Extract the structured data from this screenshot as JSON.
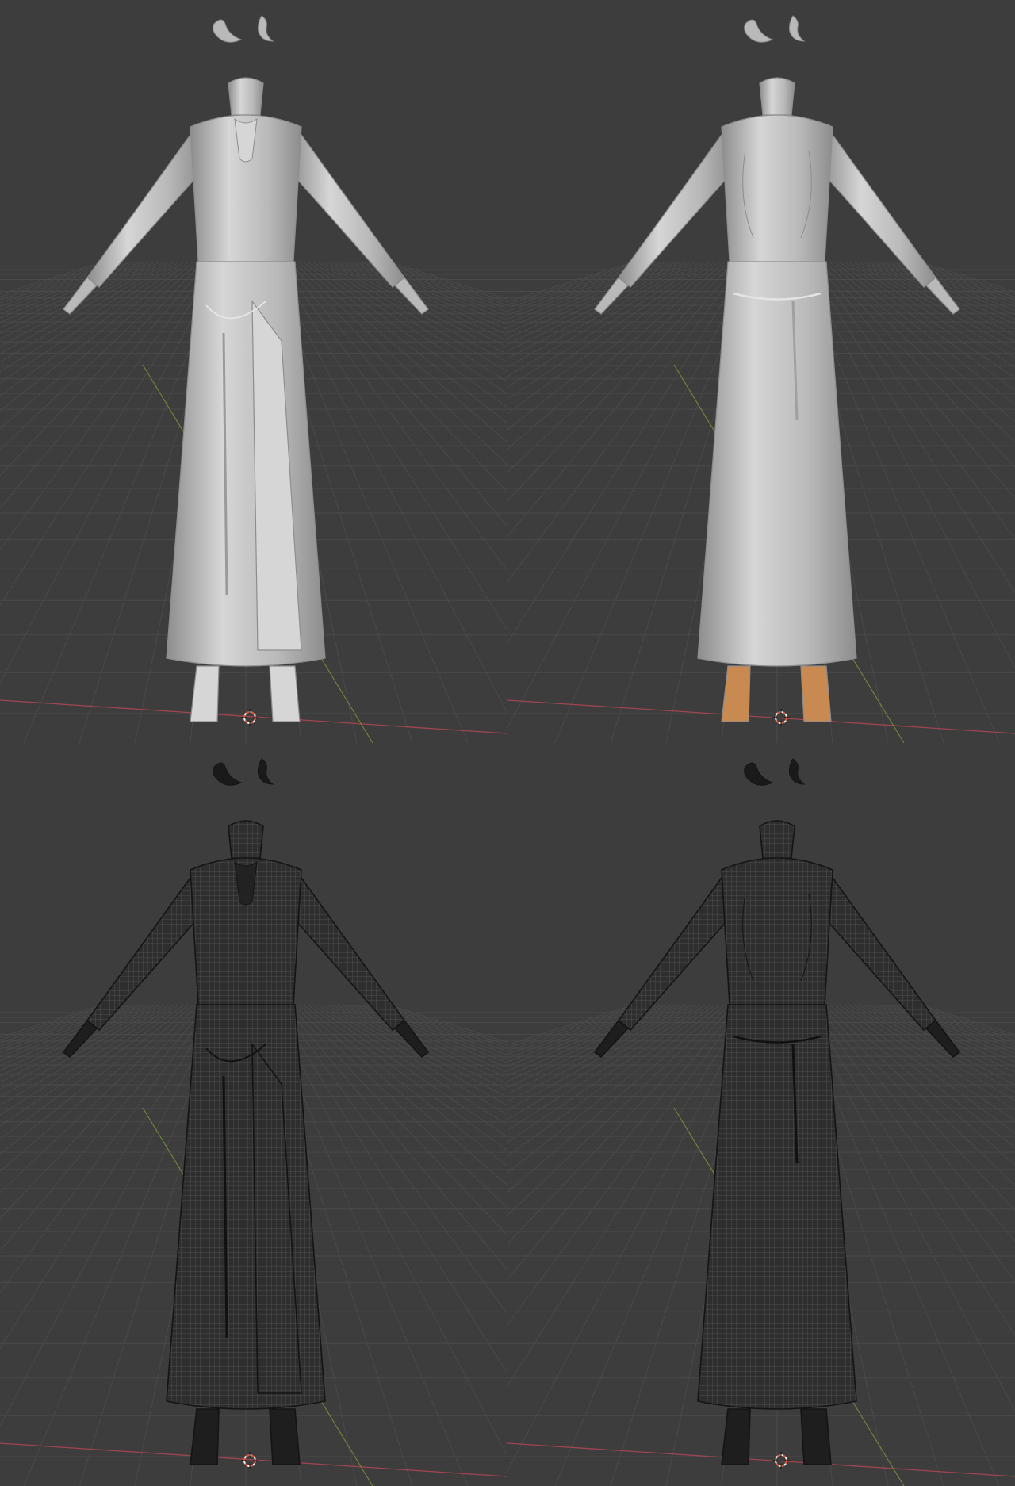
{
  "layout": {
    "viewports": [
      {
        "name": "viewport-front-solid",
        "view": "front",
        "shading": "solid"
      },
      {
        "name": "viewport-back-solid",
        "view": "back",
        "shading": "solid"
      },
      {
        "name": "viewport-front-wireframe",
        "view": "front",
        "shading": "wireframe"
      },
      {
        "name": "viewport-back-wireframe",
        "view": "back",
        "shading": "wireframe"
      }
    ]
  },
  "colors": {
    "background": "#3d3d3d",
    "grid_line": "#4a4a4a",
    "x_axis": "#a04550",
    "y_axis": "#6f8a3a",
    "cursor_red": "#e05a3c",
    "cursor_white": "#f2f2f2",
    "solid_body": "#b9b9b9",
    "solid_shadow": "#8d8d8d",
    "solid_highlight": "#d6d6d6",
    "skin_accent": "#c98a52",
    "wire_fill": "#2e2e2e",
    "wire_line": "#565656",
    "wire_edge": "#141414"
  },
  "icons": {
    "cursor": "3d-cursor-icon",
    "hair_pieces": "hair-ornament-icon"
  }
}
